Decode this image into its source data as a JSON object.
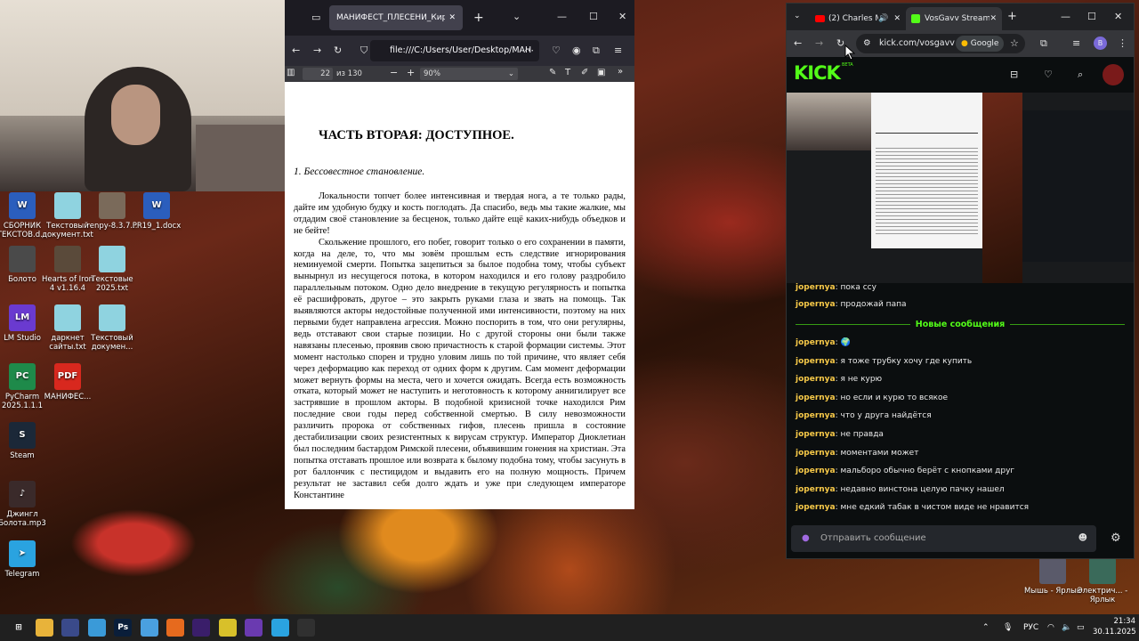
{
  "desktop": {
    "icons": [
      {
        "label": "СБОРНИК ТЕКСТОВ.d...",
        "icon": "word-doc-icon",
        "color": "#2b5ebd",
        "glyph": "W"
      },
      {
        "label": "Текстовый документ.txt",
        "icon": "text-file-icon",
        "color": "#8fd3e0",
        "glyph": ""
      },
      {
        "label": "renpy-8.3.7...",
        "icon": "folder-icon",
        "color": "#7a6a5a",
        "glyph": ""
      },
      {
        "label": "PR19_1.docx",
        "icon": "word-doc-icon",
        "color": "#2b5ebd",
        "glyph": "W"
      },
      {
        "label": "Болото",
        "icon": "folder-icon",
        "color": "#4a4a4a",
        "glyph": ""
      },
      {
        "label": "Hearts of Iron 4 v1.16.4",
        "icon": "folder-icon",
        "color": "#5a4a3a",
        "glyph": ""
      },
      {
        "label": "Текстовые 2025.txt",
        "icon": "text-file-icon",
        "color": "#8fd3e0",
        "glyph": ""
      },
      {
        "label": "LM Studio",
        "icon": "lm-studio-icon",
        "color": "#6a3ad0",
        "glyph": "LM"
      },
      {
        "label": "даркнет сайты.txt",
        "icon": "text-file-icon",
        "color": "#8fd3e0",
        "glyph": ""
      },
      {
        "label": "Текстовый докумен...",
        "icon": "text-file-icon",
        "color": "#8fd3e0",
        "glyph": ""
      },
      {
        "label": "PyCharm 2025.1.1.1",
        "icon": "pycharm-icon",
        "color": "#1e8a4a",
        "glyph": "PC"
      },
      {
        "label": "МАНИФЕС...",
        "icon": "pdf-file-icon",
        "color": "#d8281e",
        "glyph": "PDF"
      },
      {
        "label": "Steam",
        "icon": "steam-icon",
        "color": "#1b2838",
        "glyph": "S"
      },
      {
        "label": "Джингл Болота.mp3",
        "icon": "audio-file-icon",
        "color": "#3a2a2a",
        "glyph": "♪"
      },
      {
        "label": "Telegram",
        "icon": "telegram-icon",
        "color": "#2aa3e0",
        "glyph": "➤"
      },
      {
        "label": "Мышь - Ярлык",
        "icon": "shortcut-icon",
        "color": "#5a5a6a",
        "glyph": ""
      },
      {
        "label": "Электрич... - Ярлык",
        "icon": "shortcut-icon",
        "color": "#3a6a5a",
        "glyph": ""
      }
    ]
  },
  "pdf_window": {
    "tab_title": "МАНИФЕСТ_ПЛЕСЕНИ_Кирилл_...",
    "url": "file:///C:/Users/User/Desktop/МАН",
    "page_current": "22",
    "page_total": "из 130",
    "zoom": "90%",
    "heading": "ЧАСТЬ ВТОРАЯ: ДОСТУПНОЕ.",
    "subheading": "1. Бессовестное становление.",
    "paragraphs": [
      "Локальности топчет более интенсивная и твердая нога, а те только рады, дайте им удобную будку и кость поглодать. Да спасибо, ведь мы такие жалкие, мы отдадим своё становление за бесценок, только дайте ещё каких-нибудь объедков и не бейте!",
      "Скольжение прошлого, его побег, говорит только о его сохранении в памяти, когда на деле, то, что мы зовём прошлым есть следствие игнорирования неминуемой смерти. Попытка зацепиться за былое подобна тому, чтобы субъект вынырнул из несущегося потока, в котором находился и его голову раздробило параллельным потоком. Одно дело внедрение в текущую регулярность и попытка её расшифровать, другое – это закрыть руками глаза и звать на помощь. Так выявляются акторы недостойные полученной ими интенсивности, поэтому на них первыми будет направлена агрессия. Можно поспорить в том, что они регулярны, ведь отставают свои старые позиции. Но с другой стороны они были также навязаны плесенью, проявив свою причастность к старой формации системы. Этот момент настолько спорен и трудно уловим лишь по той причине, что являет себя через деформацию как переход от одних форм к другим. Сам момент деформации может вернуть формы на места, чего и хочется ожидать. Всегда есть возможность отката, который может не наступить и неготовность к которому аннигилирует все застрявшие в прошлом акторы. В подобной кризисной точке находился Рим последние свои годы перед собственной смертью. В силу невозможности различить пророка от собственных гифов, плесень пришла в состояние дестабилизации своих резистентных к вирусам структур. Император Диоклетиан был последним бастардом Римской плесени, объявившим гонения на христиан. Эта попытка отставать прошлое или возврата к былому подобна тому, чтобы засунуть в рот баллончик с пестицидом и выдавить его на полную мощность. Причем результат не заставил себя долго ждать и уже при следующем императоре Константине"
    ]
  },
  "chrome_window": {
    "tabs": [
      {
        "label": "(2) Charles M",
        "active": false
      },
      {
        "label": "VosGavv Stream",
        "active": true
      }
    ],
    "url": "kick.com/vosgavv",
    "google_label": "Google",
    "profile_initial": "B",
    "kick_logo": "KICK",
    "kick_beta": "BETA",
    "chat": {
      "top_partial": {
        "user": "jopernya",
        "text": "пока ссу"
      },
      "before_divider": {
        "user": "jopernya",
        "text": "продожай папа"
      },
      "divider": "Новые сообщения",
      "messages": [
        {
          "user": "jopernya",
          "text": "🌍"
        },
        {
          "user": "jopernya",
          "text": "я тоже трубку хочу где купить"
        },
        {
          "user": "jopernya",
          "text": "я не курю"
        },
        {
          "user": "jopernya",
          "text": "но если и курю то всякое"
        },
        {
          "user": "jopernya",
          "text": "что у друга найдётся"
        },
        {
          "user": "jopernya",
          "text": "не правда"
        },
        {
          "user": "jopernya",
          "text": "моментами может"
        },
        {
          "user": "jopernya",
          "text": "мальборо обычно берёт с кнопками друг"
        },
        {
          "user": "jopernya",
          "text": "недавно винстона целую пачку нашел"
        },
        {
          "user": "jopernya",
          "text": "мне едкий табак в чистом виде не нравится"
        }
      ],
      "input_placeholder": "Отправить сообщение"
    }
  },
  "taskbar": {
    "language": "РУС",
    "time": "21:34",
    "date": "30.11.2025",
    "apps": [
      {
        "name": "windows-start-icon",
        "glyph": "⊞",
        "color": "#202020"
      },
      {
        "name": "file-explorer-icon",
        "glyph": "",
        "color": "#e8b33a"
      },
      {
        "name": "app-icon",
        "glyph": "",
        "color": "#3a4a8a"
      },
      {
        "name": "notepad-icon",
        "glyph": "",
        "color": "#3a9ad8"
      },
      {
        "name": "photoshop-icon",
        "glyph": "Ps",
        "color": "#0a1e3a"
      },
      {
        "name": "files-icon",
        "glyph": "",
        "color": "#4aa0e0"
      },
      {
        "name": "firefox-icon",
        "glyph": "",
        "color": "#e66a1e"
      },
      {
        "name": "obs-purple-icon",
        "glyph": "",
        "color": "#3a1e6a"
      },
      {
        "name": "chrome-icon",
        "glyph": "",
        "color": "#d8c02a"
      },
      {
        "name": "visual-studio-icon",
        "glyph": "",
        "color": "#6a3ab0"
      },
      {
        "name": "telegram-taskbar-icon",
        "glyph": "",
        "color": "#2aa3e0"
      },
      {
        "name": "obs-icon",
        "glyph": "",
        "color": "#303030"
      }
    ]
  }
}
